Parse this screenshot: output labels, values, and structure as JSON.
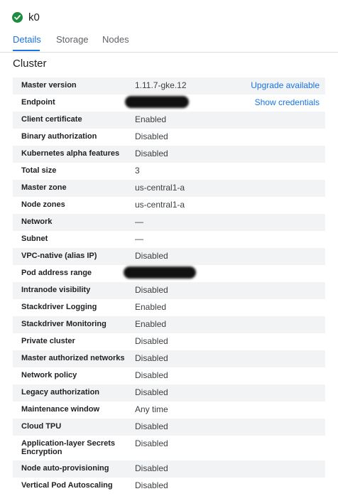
{
  "header": {
    "cluster_name": "k0"
  },
  "tabs": [
    {
      "label": "Details"
    },
    {
      "label": "Storage"
    },
    {
      "label": "Nodes"
    }
  ],
  "section": {
    "title": "Cluster"
  },
  "rows": [
    {
      "label": "Master version",
      "value": "1.11.7-gke.12",
      "link": "Upgrade available"
    },
    {
      "label": "Endpoint",
      "value": "",
      "link": "Show credentials"
    },
    {
      "label": "Client certificate",
      "value": "Enabled"
    },
    {
      "label": "Binary authorization",
      "value": "Disabled"
    },
    {
      "label": "Kubernetes alpha features",
      "value": "Disabled"
    },
    {
      "label": "Total size",
      "value": "3"
    },
    {
      "label": "Master zone",
      "value": "us-central1-a"
    },
    {
      "label": "Node zones",
      "value": "us-central1-a"
    },
    {
      "label": "Network",
      "value": "—"
    },
    {
      "label": "Subnet",
      "value": "—"
    },
    {
      "label": "VPC-native (alias IP)",
      "value": "Disabled"
    },
    {
      "label": "Pod address range",
      "value": ""
    },
    {
      "label": "Intranode visibility",
      "value": "Disabled"
    },
    {
      "label": "Stackdriver Logging",
      "value": "Enabled"
    },
    {
      "label": "Stackdriver Monitoring",
      "value": "Enabled"
    },
    {
      "label": "Private cluster",
      "value": "Disabled"
    },
    {
      "label": "Master authorized networks",
      "value": "Disabled"
    },
    {
      "label": "Network policy",
      "value": "Disabled"
    },
    {
      "label": "Legacy authorization",
      "value": "Disabled"
    },
    {
      "label": "Maintenance window",
      "value": "Any time"
    },
    {
      "label": "Cloud TPU",
      "value": "Disabled"
    },
    {
      "label": "Application-layer Secrets Encryption",
      "value": "Disabled"
    },
    {
      "label": "Node auto-provisioning",
      "value": "Disabled"
    },
    {
      "label": "Vertical Pod Autoscaling",
      "value": "Disabled"
    }
  ]
}
